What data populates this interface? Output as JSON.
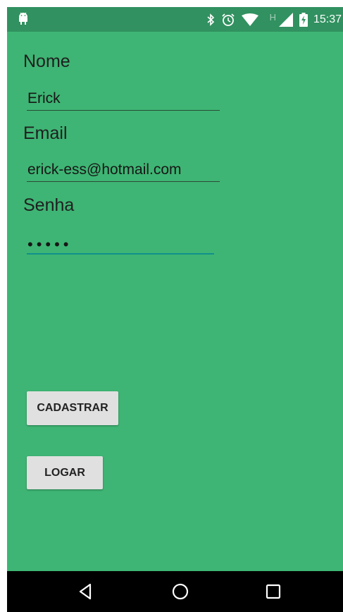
{
  "status_bar": {
    "notification_icon": "android-icon",
    "icons": [
      "bluetooth-icon",
      "alarm-icon",
      "wifi-icon",
      "signal-icon",
      "battery-charging-icon"
    ],
    "network_indicator": "H",
    "time": "15:37"
  },
  "form": {
    "name_label": "Nome",
    "name_value": "Erick",
    "email_label": "Email",
    "email_value": "erick-ess@hotmail.com",
    "password_label": "Senha",
    "password_masked": "•••••"
  },
  "buttons": {
    "register_label": "CADASTRAR",
    "login_label": "LOGAR"
  },
  "nav_bar": {
    "icons": [
      "back-icon",
      "home-icon",
      "recents-icon"
    ]
  },
  "colors": {
    "background": "#3eb574",
    "status_bar": "#319160",
    "accent": "#10908c",
    "button": "#e0e0e0",
    "nav_bar": "#000000"
  }
}
